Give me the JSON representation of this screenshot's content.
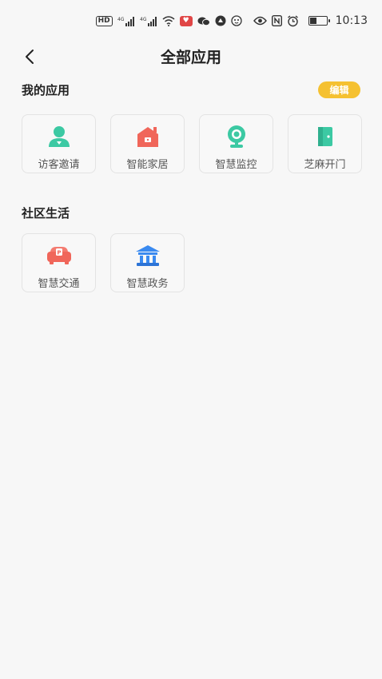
{
  "status_bar": {
    "hd_badge": "HD",
    "signal_label_1": "4G",
    "signal_label_2": "4G",
    "battery_level": 0.45,
    "time": "10:13"
  },
  "nav": {
    "title": "全部应用",
    "back_icon": "chevron-left-icon"
  },
  "my_apps": {
    "title": "我的应用",
    "edit_label": "编辑",
    "edit_color": "#f5c131",
    "items": [
      {
        "label": "访客邀请",
        "icon": "visitor-icon",
        "color": "#3cc9a3"
      },
      {
        "label": "智能家居",
        "icon": "smart-home-icon",
        "color": "#f0665a"
      },
      {
        "label": "智慧监控",
        "icon": "camera-icon",
        "color": "#3cc9a3"
      },
      {
        "label": "芝麻开门",
        "icon": "door-icon",
        "color": "#3cc9a3"
      }
    ]
  },
  "community": {
    "title": "社区生活",
    "items": [
      {
        "label": "智慧交通",
        "icon": "parking-icon",
        "color": "#f0665a"
      },
      {
        "label": "智慧政务",
        "icon": "government-icon",
        "color": "#3a8af0"
      }
    ]
  }
}
